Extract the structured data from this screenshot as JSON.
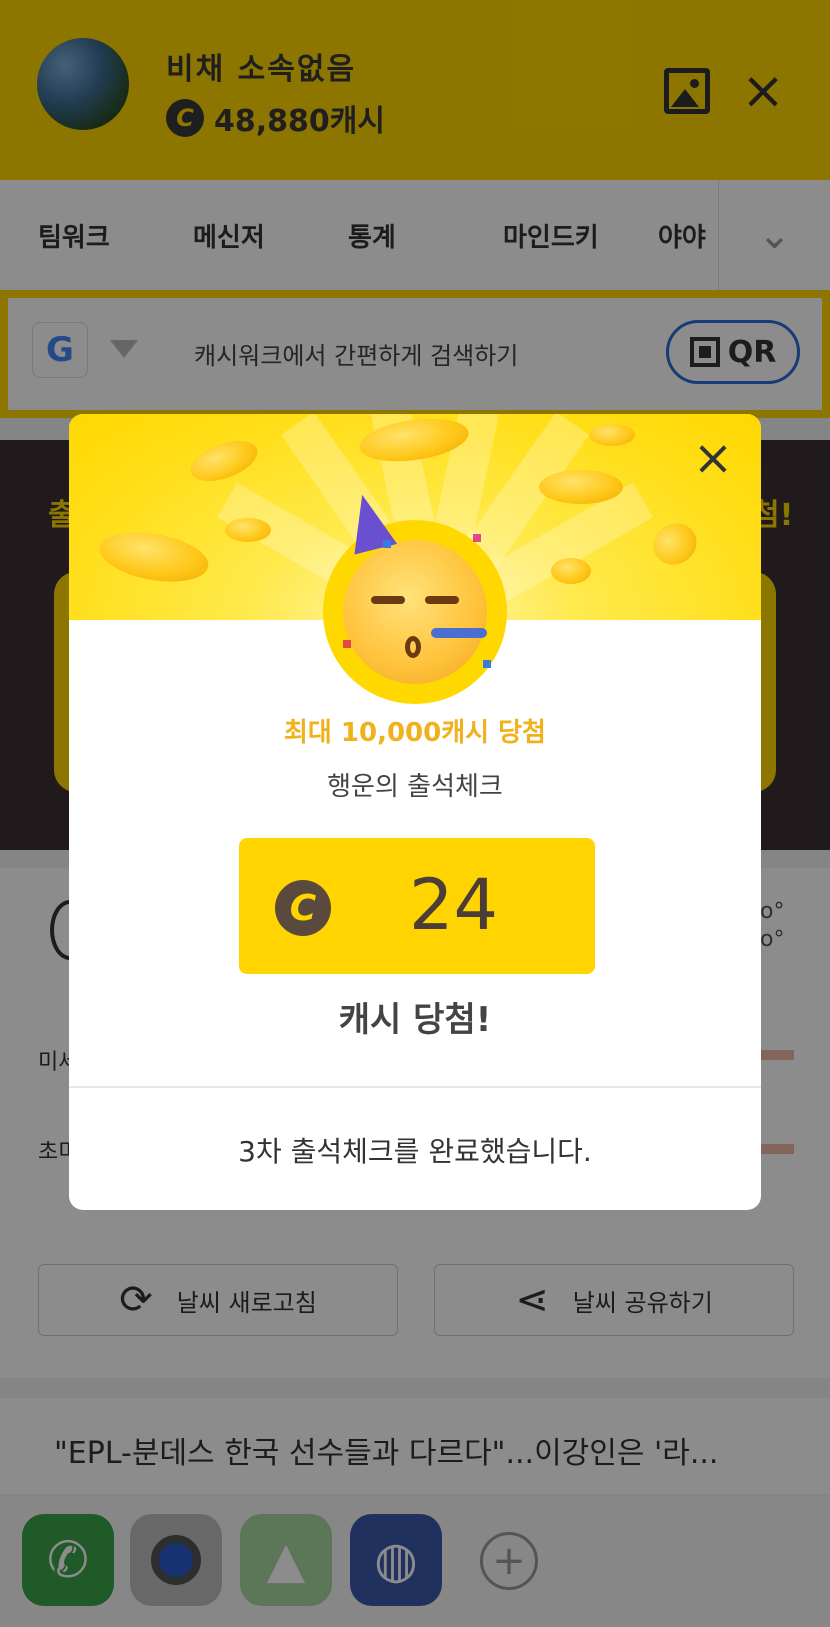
{
  "header": {
    "user_name": "비채 소속없음",
    "coin_symbol": "C",
    "cash_amount": "48,880캐시",
    "image_icon": "image-icon",
    "close_icon": "close-icon"
  },
  "tabs": {
    "items": [
      {
        "label": "팀워크"
      },
      {
        "label": "메신저"
      },
      {
        "label": "통계"
      },
      {
        "label": "마인드키"
      },
      {
        "label": "야야"
      }
    ],
    "more_icon": "chevron-down-icon"
  },
  "search": {
    "engine_letter": "G",
    "placeholder": "캐시워크에서 간편하게 검색하기",
    "qr_label": "QR"
  },
  "banner": {
    "left_text": "출",
    "right_text": "첨!"
  },
  "weather": {
    "row1_label": "미세",
    "row2_label": "초미",
    "refresh_label": "날씨 새로고침",
    "share_label": "날씨 공유하기"
  },
  "news": {
    "headline": "\"EPL-분데스 한국 선수들과 다르다\"...이강인은 '라..."
  },
  "dock": {
    "add_symbol": "+"
  },
  "modal": {
    "close_symbol": "×",
    "subtitle": "최대 10,000캐시 당첨",
    "title": "행운의 출석체크",
    "coin_symbol": "C",
    "prize_value": "24",
    "prize_caption": "캐시 당첨!",
    "message": "3차 출석체크를 완료했습니다."
  },
  "colors": {
    "brand_yellow": "#ffd800",
    "accent_orange": "#f0b21a",
    "qr_border": "#2b6cd4"
  }
}
